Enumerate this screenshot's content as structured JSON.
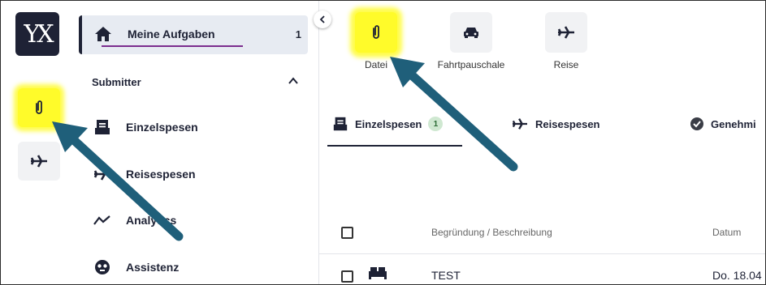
{
  "logo": {
    "text": "YX"
  },
  "sidebar": {
    "active": {
      "label": "Meine Aufgaben",
      "count": "1",
      "icon": "home-icon"
    },
    "section": "Submitter",
    "items": [
      {
        "label": "Einzelspesen",
        "icon": "receipt-icon"
      },
      {
        "label": "Reisespesen",
        "icon": "airplane-icon"
      },
      {
        "label": "Analytics",
        "icon": "analytics-icon"
      },
      {
        "label": "Assistenz",
        "icon": "assistant-icon"
      }
    ]
  },
  "toolbar": [
    {
      "label": "Datei",
      "icon": "paperclip-icon"
    },
    {
      "label": "Fahrtpauschale",
      "icon": "car-icon"
    },
    {
      "label": "Reise",
      "icon": "airplane-icon"
    }
  ],
  "tabs": [
    {
      "label": "Einzelspesen",
      "badge": "1",
      "icon": "receipt-icon"
    },
    {
      "label": "Reisespesen",
      "icon": "airplane-icon"
    },
    {
      "label": "Genehmi",
      "icon": "check-circle-icon"
    }
  ],
  "table": {
    "headers": [
      "Begründung / Beschreibung",
      "Datum"
    ],
    "rows": [
      {
        "description": "TEST",
        "date": "Do. 18.04"
      }
    ]
  },
  "colors": {
    "highlight": "#fffb2a",
    "arrow": "#1f5f7a",
    "dark": "#1e2235",
    "underline": "#7b2d8e"
  }
}
